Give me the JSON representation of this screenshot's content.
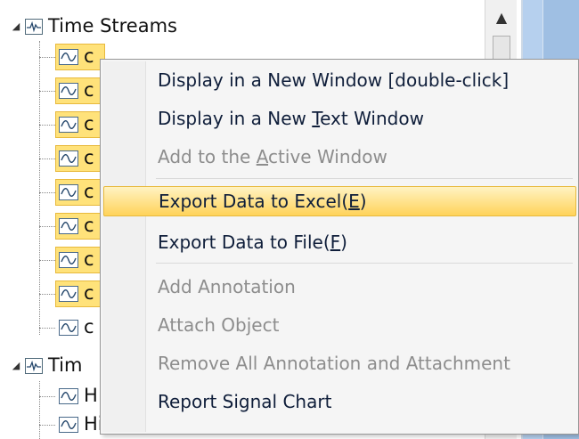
{
  "tree": {
    "group1": {
      "label": "Time Streams",
      "expander": "◢"
    },
    "group1_items": [
      "c",
      "c",
      "c",
      "c",
      "c",
      "c",
      "c",
      "c",
      "c"
    ],
    "group2": {
      "label": "Tim",
      "expander": "◢"
    },
    "group2_items": [
      "H",
      "Hist_Profile_RMS"
    ]
  },
  "context_menu": {
    "items": [
      {
        "label": "Display in a New Window [double-click]",
        "disabled": false,
        "highlight": false
      },
      {
        "label_pre": "Display in a New ",
        "label_key": "T",
        "label_post": "ext Window",
        "disabled": false,
        "highlight": false
      },
      {
        "label_pre": "Add to the ",
        "label_key": "A",
        "label_post": "ctive Window",
        "disabled": true,
        "highlight": false
      },
      {
        "label_pre": "Export Data to Excel(",
        "label_key": "E",
        "label_post": ")",
        "disabled": false,
        "highlight": true
      },
      {
        "label_pre": "Export Data to File(",
        "label_key": "F",
        "label_post": ")",
        "disabled": false,
        "highlight": false
      },
      {
        "label": "Add Annotation",
        "disabled": true,
        "highlight": false
      },
      {
        "label": "Attach Object",
        "disabled": true,
        "highlight": false
      },
      {
        "label": "Remove All Annotation and Attachment",
        "disabled": true,
        "highlight": false
      },
      {
        "label": "Report Signal Chart",
        "disabled": false,
        "highlight": false
      }
    ]
  },
  "scrollbar": {
    "up_arrow": "▲"
  },
  "colors": {
    "highlight": "#ffd35a",
    "disabled_text": "#8d8d8d",
    "menu_text": "#0f1e3a",
    "right_pane": "#b6d0ee"
  }
}
